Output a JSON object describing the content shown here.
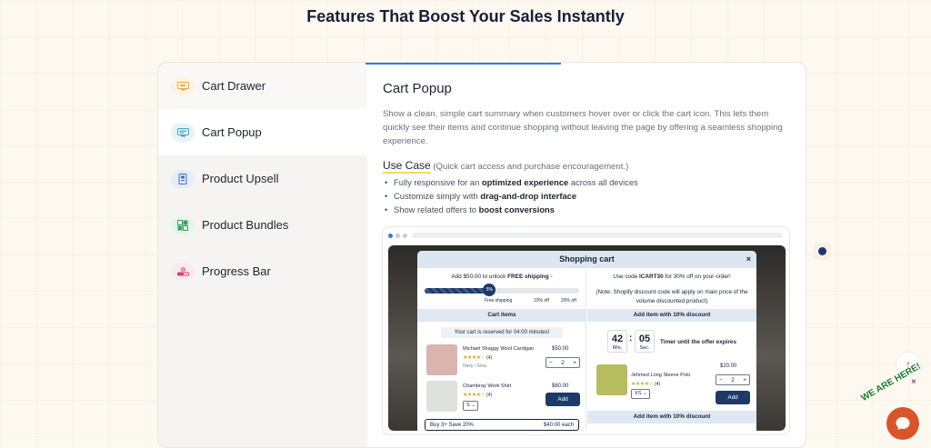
{
  "page": {
    "headline": "Features That Boost Your Sales Instantly"
  },
  "sidebar": {
    "items": [
      {
        "label": "Cart Drawer",
        "icon": "cart-drawer-icon",
        "icon_color": "#f2a93b",
        "icon_bg": "#faf3e6"
      },
      {
        "label": "Cart Popup",
        "icon": "cart-popup-icon",
        "icon_color": "#4aa3c9",
        "icon_bg": "#e6f4f8"
      },
      {
        "label": "Product Upsell",
        "icon": "product-upsell-icon",
        "icon_color": "#3a6bd1",
        "icon_bg": "#e6edfa"
      },
      {
        "label": "Product Bundles",
        "icon": "product-bundles-icon",
        "icon_color": "#39a35a",
        "icon_bg": "#e5f5ea"
      },
      {
        "label": "Progress Bar",
        "icon": "progress-bar-icon",
        "icon_color": "#d6456b",
        "icon_bg": "#fbe9ee"
      }
    ]
  },
  "content": {
    "title": "Cart Popup",
    "description": "Show a clean, simple cart summary when customers hover over or click the cart icon. This lets them quickly see their items and continue shopping without leaving the page by offering a seamless shopping experience.",
    "use_case_label": "Use Case",
    "use_case_note": "(Quick cart access and purchase encouragement.)",
    "bullets": [
      {
        "prefix": "Fully responsive for an ",
        "bold": "optimized experience",
        "suffix": " across all devices"
      },
      {
        "prefix": "Customize simply with ",
        "bold": "drag-and-drop interface",
        "suffix": ""
      },
      {
        "prefix": "Show related offers to ",
        "bold": "boost conversions",
        "suffix": ""
      }
    ]
  },
  "preview": {
    "cart_title": "Shopping cart",
    "close": "×",
    "left": {
      "shipping_prefix": "Add $50.00 to unlock ",
      "shipping_bold": "FREE shipping",
      "progress_fraction": 0.42,
      "progress_badge": "5%",
      "milestones": [
        "Free shipping",
        "10% off",
        "20% off"
      ],
      "section_title": "Cart items",
      "reserved": "Your cart is reserved for 04:00 minutes!",
      "items": [
        {
          "name": "Michael Shaggy Wool Cardigan",
          "stars": "★★★★☆",
          "reviews": "(4)",
          "variant": "Navy / Sma",
          "price": "$50.00",
          "qty": "2"
        },
        {
          "name": "Chambray Work Shirt",
          "stars": "★★★★☆",
          "reviews": "(4)",
          "size": "S",
          "price": "$60.00",
          "button": "Add"
        }
      ],
      "bundle_label": "Buy 3+ Save 20%",
      "bundle_price": "$40.00 each"
    },
    "right": {
      "code_prefix": "Use code ",
      "code": "ICART30",
      "code_suffix": " for 30% off on your order!",
      "note": "(Note: Shopify discount code will apply on main price of the volume discounted product)",
      "band": "Add item with 10% discount",
      "timer": {
        "minutes": "42",
        "min_label": "Min.",
        "seconds": "05",
        "sec_label": "Sec.",
        "caption": "Timer until the offer expires"
      },
      "item": {
        "name": "Jehmed Long Sleeve Polo",
        "stars": "★★★★☆",
        "reviews": "(4)",
        "price": "$20.00",
        "qty": "2",
        "size": "XS",
        "button": "Add"
      },
      "band2": "Add item with 10% discount"
    }
  },
  "widgets": {
    "badge_text": "WE ARE HERE!",
    "close": "×",
    "scroll_top": "↑"
  }
}
